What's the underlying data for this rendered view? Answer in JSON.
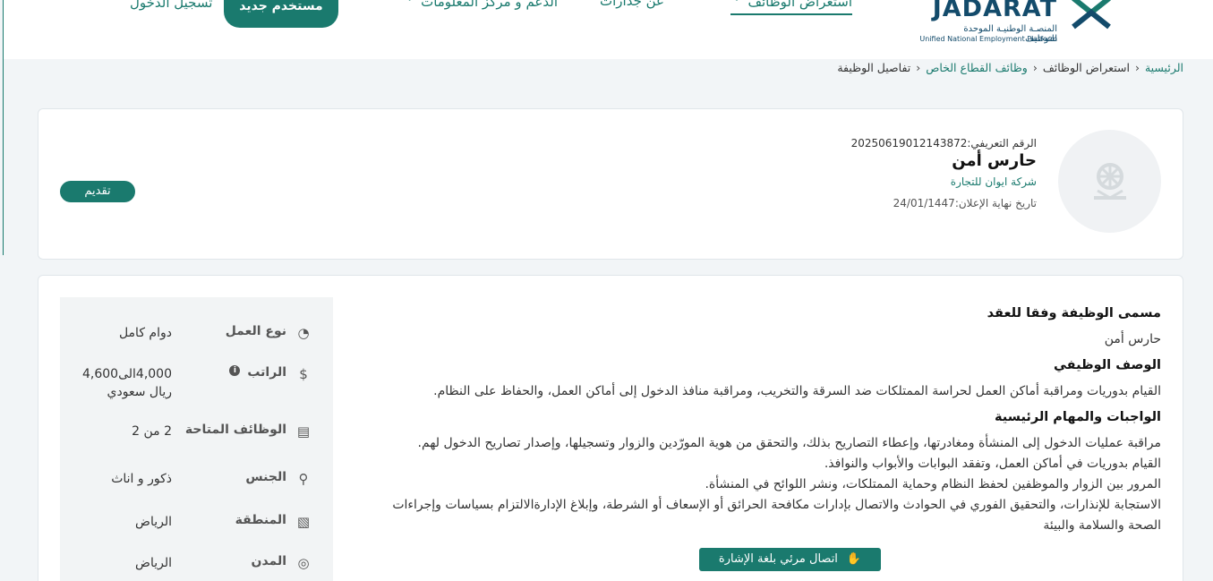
{
  "header": {
    "logo": {
      "name": "JADARAT",
      "subtitle_ar": "المنصـة الوطنيـة الموحدة للتوظيف",
      "subtitle_en": "Unified National Employment Platform"
    },
    "nav": {
      "browse_jobs": "استعراض الوظائف",
      "about": "عن جدارات",
      "support": "الدعم و مركز المعلومات"
    },
    "new_user": "مستخدم جديد",
    "login": "تسجيل الدخول"
  },
  "breadcrumb": {
    "home": "الرئيسية",
    "browse": "استعراض الوظائف",
    "private_jobs": "وظائف القطاع الخاص",
    "current": "تفاصيل الوظيفة",
    "separator": "‹"
  },
  "job": {
    "ref_label": "الرقم التعريفي:",
    "ref_value": "20250619012143872",
    "title": "حارس أمن",
    "company": "شركة ايوان للتجارة",
    "deadline_label": "تاريخ نهاية الإعلان:",
    "deadline_value": "24/01/1447",
    "apply": "تقديم"
  },
  "side": [
    {
      "icon": "pie-chart-icon",
      "glyph": "◔",
      "label": "نوع العمل",
      "value": "دوام كامل"
    },
    {
      "icon": "salary-icon",
      "glyph": "$",
      "label": "الراتب",
      "value": "4,000الى4,600 ريال سعودي"
    },
    {
      "icon": "id-card-icon",
      "glyph": "▤",
      "label": "الوظائف المتاحة",
      "value": "2 من 2"
    },
    {
      "icon": "gender-icon",
      "glyph": "⚲",
      "label": "الجنس",
      "value": "ذكور و اناث"
    },
    {
      "icon": "map-icon",
      "glyph": "▧",
      "label": "المنطقة",
      "value": "الرياض"
    },
    {
      "icon": "location-pin-icon",
      "glyph": "◎",
      "label": "المدن",
      "value": "الرياض"
    }
  ],
  "content": {
    "contract_title_heading": "مسمى الوظيفة وفقا للعقد",
    "contract_title_value": "حارس أمن",
    "description_heading": "الوصف الوظيفي",
    "description_value": "القيام بدوريات ومراقبة أماكن العمل لحراسة الممتلكات ضد السرقة والتخريب، ومراقبة منافذ الدخول إلى أماكن العمل، والحفاظ على النظام.",
    "duties_heading": "الواجبات والمهام الرئيسية",
    "duties": [
      "مراقبة عمليات الدخول إلى المنشأة ومغادرتها، وإعطاء التصاريح بذلك، والتحقق من هوية المورّدين والزوار وتسجيلها، وإصدار تصاريح الدخول لهم.",
      "القيام بدوريات في أماكن العمل، وتفقد البوابات والأبواب والنوافذ.",
      "المرور بين الزوار والموظفين لحفظ النظام وحماية الممتلكات، ونشر اللوائح في المنشأة.",
      "الاستجابة للإنذارات، والتحقيق الفوري في الحوادث والاتصال بإدارات مكافحة الحرائق أو الإسعاف أو الشرطة، وإبلاغ الإدارةالالتزام بسياسات وإجراءات الصحة والسلامة والبيئة"
    ]
  },
  "sign_language": "اتصال مرئي بلغة الإشارة"
}
